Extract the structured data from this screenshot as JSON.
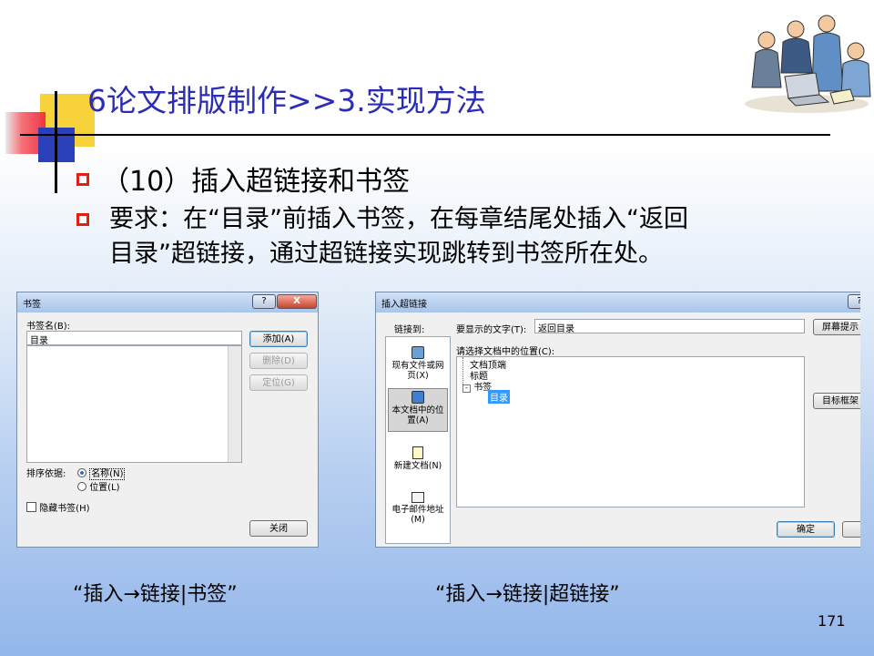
{
  "slide": {
    "title": "6论文排版制作>>3.实现方法",
    "bullet1": "（10）插入超链接和书签",
    "bullet2_line1": "要求：在“目录”前插入书签，在每章结尾处插入“返回",
    "bullet2_line2": "目录”超链接，通过超链接实现跳转到书签所在处。",
    "caption_left": "“插入→链接|书签”",
    "caption_right": "“插入→链接|超链接”",
    "page_number": "171"
  },
  "bookmark_dialog": {
    "title": "书签",
    "help_btn": "?",
    "close_btn": "X",
    "name_label": "书签名(B):",
    "name_value": "目录",
    "add_btn": "添加(A)",
    "delete_btn": "删除(D)",
    "goto_btn": "定位(G)",
    "sort_label": "排序依据:",
    "sort_name": "名称(N)",
    "sort_position": "位置(L)",
    "hidden_label": "隐藏书签(H)",
    "close_button": "关闭"
  },
  "hyperlink_dialog": {
    "title": "插入超链接",
    "help_btn": "?",
    "link_to_label": "链接到:",
    "display_text_label": "要显示的文字(T):",
    "display_text_value": "返回目录",
    "screentip_btn": "屏幕提示",
    "location_label": "请选择文档中的位置(C):",
    "tree": [
      "文档顶端",
      "标题",
      "书签",
      "目录"
    ],
    "nav": [
      "现有文件或网页(X)",
      "本文档中的位置(A)",
      "新建文档(N)",
      "电子邮件地址(M)"
    ],
    "target_frame_btn": "目标框架",
    "ok_btn": "确定"
  }
}
